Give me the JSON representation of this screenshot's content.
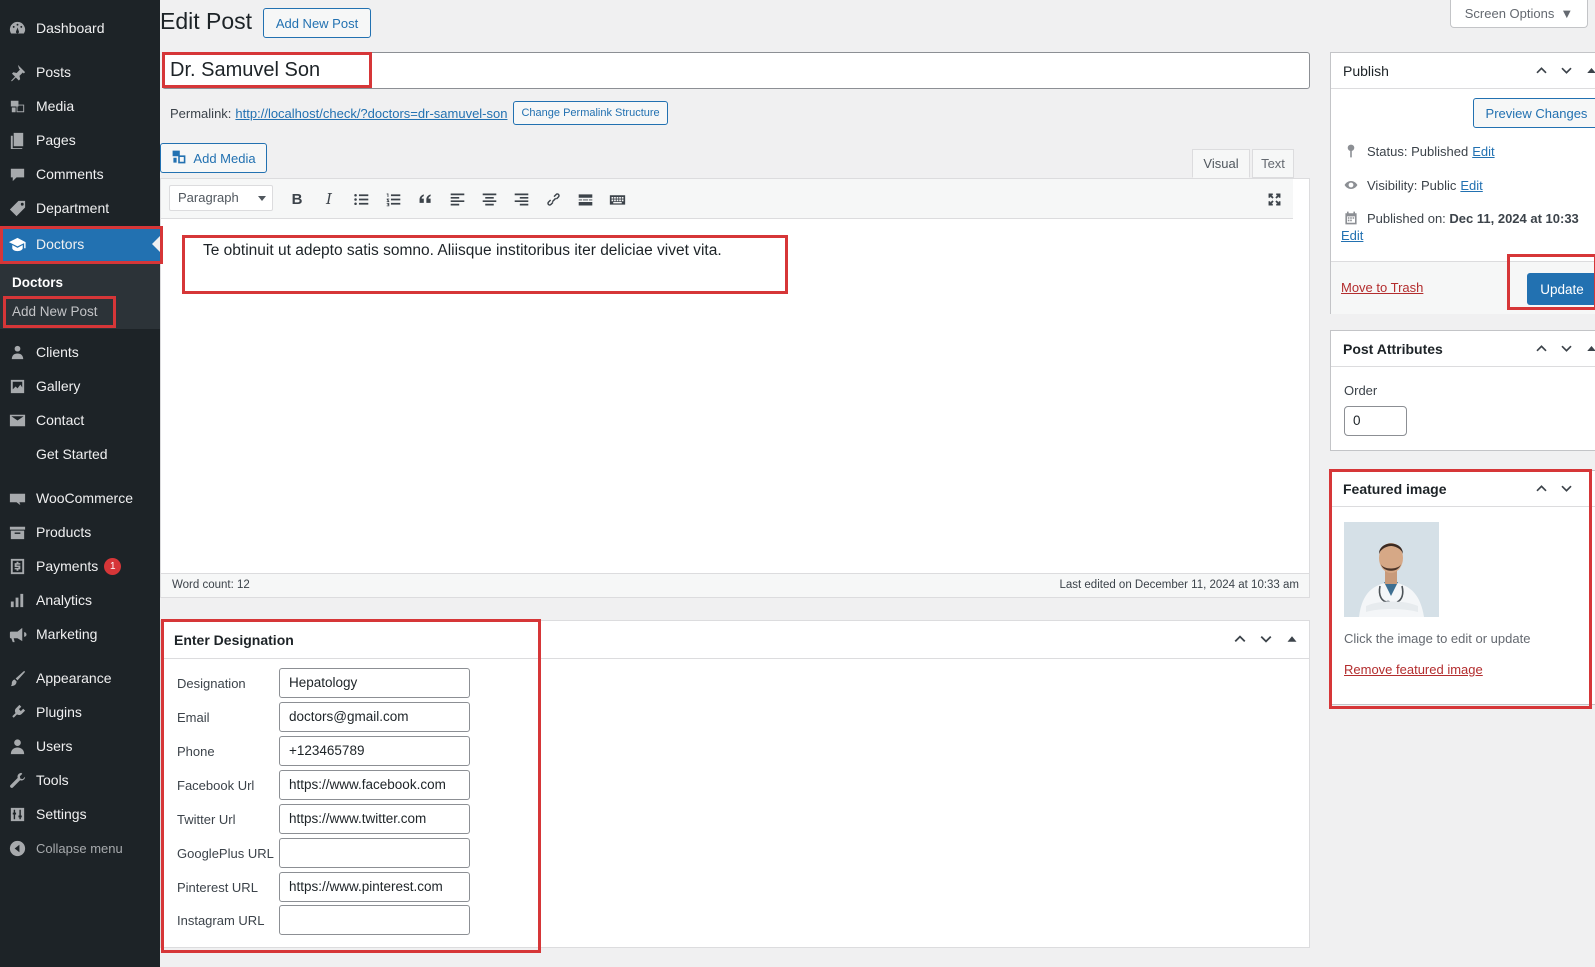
{
  "sidebar": {
    "items": [
      {
        "label": "Dashboard",
        "icon": "dashboard-icon"
      },
      {
        "label": "Posts",
        "icon": "pin-icon"
      },
      {
        "label": "Media",
        "icon": "media-icon"
      },
      {
        "label": "Pages",
        "icon": "pages-icon"
      },
      {
        "label": "Comments",
        "icon": "comment-icon"
      },
      {
        "label": "Department",
        "icon": "tag-icon"
      },
      {
        "label": "Doctors",
        "icon": "graduation-cap-icon"
      },
      {
        "label": "Clients",
        "icon": "groups-icon"
      },
      {
        "label": "Gallery",
        "icon": "gallery-icon"
      },
      {
        "label": "Contact",
        "icon": "email-icon"
      },
      {
        "label": "Get Started",
        "icon": ""
      },
      {
        "label": "WooCommerce",
        "icon": "woo-icon"
      },
      {
        "label": "Products",
        "icon": "archive-icon"
      },
      {
        "label": "Payments",
        "icon": "payment-icon",
        "badge": "1"
      },
      {
        "label": "Analytics",
        "icon": "chart-icon"
      },
      {
        "label": "Marketing",
        "icon": "megaphone-icon"
      },
      {
        "label": "Appearance",
        "icon": "brush-icon"
      },
      {
        "label": "Plugins",
        "icon": "plugin-icon"
      },
      {
        "label": "Users",
        "icon": "user-icon"
      },
      {
        "label": "Tools",
        "icon": "wrench-icon"
      },
      {
        "label": "Settings",
        "icon": "sliders-icon"
      }
    ],
    "submenu": {
      "current": "Doctors",
      "add_new": "Add New Post"
    },
    "collapse_label": "Collapse menu"
  },
  "header": {
    "title": "Edit Post",
    "add_new": "Add New Post",
    "screen_options": "Screen Options"
  },
  "post": {
    "title": "Dr. Samuvel Son",
    "permalink_label": "Permalink:",
    "permalink_url": "http://localhost/check/?doctors=dr-samuvel-son",
    "change_permalink": "Change Permalink Structure",
    "add_media": "Add Media",
    "tab_visual": "Visual",
    "tab_text": "Text",
    "format": "Paragraph",
    "content": "Te obtinuit ut adepto satis somno. Aliisque institoribus iter deliciae vivet vita.",
    "word_count": "Word count: 12",
    "last_edited": "Last edited on December 11, 2024 at 10:33 am"
  },
  "designation": {
    "title": "Enter Designation",
    "fields": [
      {
        "label": "Designation",
        "value": "Hepatology"
      },
      {
        "label": "Email",
        "value": "doctors@gmail.com"
      },
      {
        "label": "Phone",
        "value": "+123465789"
      },
      {
        "label": "Facebook Url",
        "value": "https://www.facebook.com"
      },
      {
        "label": "Twitter Url",
        "value": "https://www.twitter.com"
      },
      {
        "label": "GooglePlus URL",
        "value": ""
      },
      {
        "label": "Pinterest URL",
        "value": "https://www.pinterest.com"
      },
      {
        "label": "Instagram URL",
        "value": ""
      }
    ]
  },
  "publish": {
    "title": "Publish",
    "preview": "Preview Changes",
    "status_label": "Status:",
    "status_value": "Published",
    "visibility_label": "Visibility:",
    "visibility_value": "Public",
    "published_on_label": "Published on:",
    "published_on_value": "Dec 11, 2024 at 10:33",
    "edit": "Edit",
    "move_to_trash": "Move to Trash",
    "update": "Update"
  },
  "attributes": {
    "title": "Post Attributes",
    "order_label": "Order",
    "order_value": "0"
  },
  "featured": {
    "title": "Featured image",
    "hint": "Click the image to edit or update",
    "remove": "Remove featured image"
  },
  "colors": {
    "sidebar_bg": "#1d2327",
    "accent": "#2271b1",
    "highlight": "#d63638",
    "trash": "#b32d2e"
  }
}
